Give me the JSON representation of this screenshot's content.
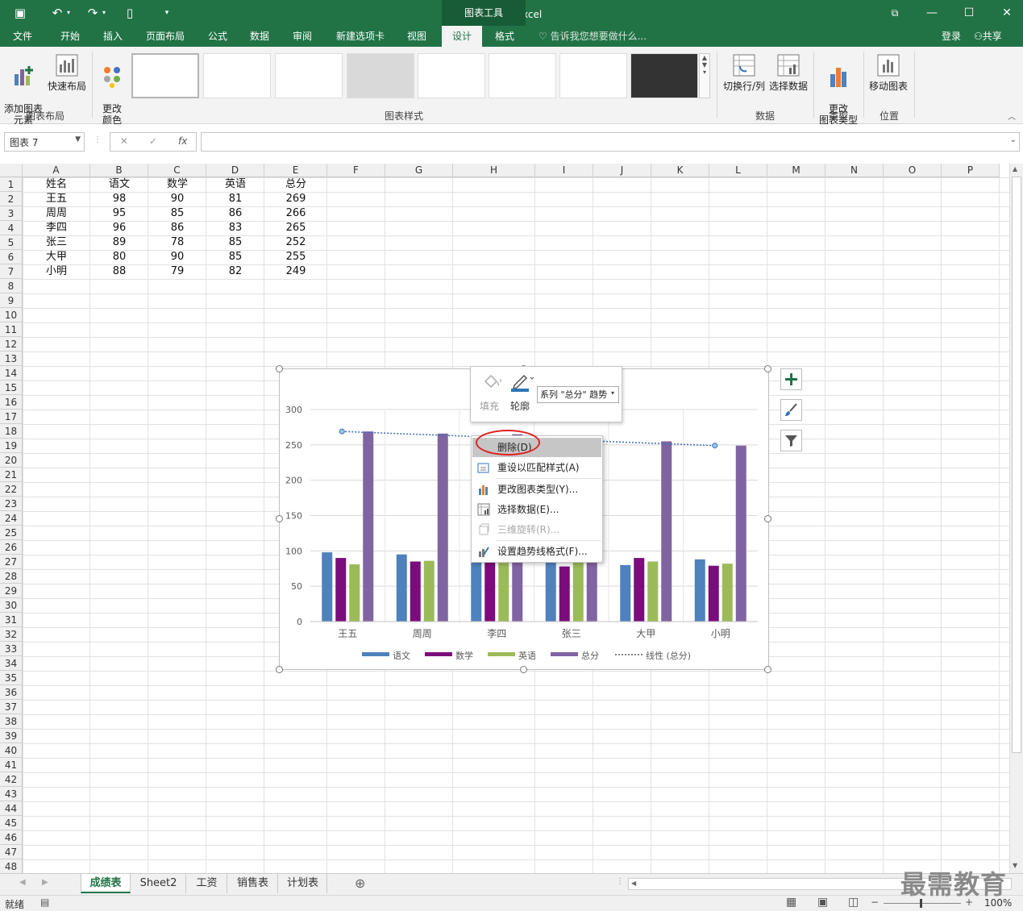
{
  "titlebar": {
    "title": "表格1 - Excel",
    "chart_tools": "图表工具"
  },
  "tabs": [
    "文件",
    "开始",
    "插入",
    "页面布局",
    "公式",
    "数据",
    "审阅",
    "新建选项卡",
    "视图",
    "设计",
    "格式"
  ],
  "active_tab": "设计",
  "tell_me": "告诉我您想要做什么...",
  "account": {
    "login": "登录",
    "share": "共享"
  },
  "ribbon": {
    "add_element": "添加图表\n元素",
    "quick_layout": "快速布局",
    "change_color": "更改\n颜色",
    "switch_row_col": "切换行/列",
    "select_data": "选择数据",
    "change_type": "更改\n图表类型",
    "move_chart": "移动图表",
    "groups": {
      "layout": "图表布局",
      "styles": "图表样式",
      "data": "数据",
      "type": "类型",
      "location": "位置"
    }
  },
  "name_box": "图表 7",
  "fx_label": "fx",
  "columns": [
    "A",
    "B",
    "C",
    "D",
    "E",
    "F",
    "G",
    "H",
    "I",
    "J",
    "K",
    "L",
    "M",
    "N",
    "O",
    "P"
  ],
  "rows": [
    "1",
    "2",
    "3",
    "4",
    "5",
    "6",
    "7",
    "8",
    "9",
    "10",
    "11",
    "12",
    "13",
    "14",
    "15",
    "16",
    "17",
    "18",
    "19",
    "20",
    "21",
    "22",
    "23",
    "24",
    "25",
    "26",
    "27",
    "28",
    "29",
    "30",
    "31",
    "32",
    "33",
    "34",
    "35",
    "36",
    "37",
    "38",
    "39",
    "40",
    "41",
    "42",
    "43",
    "44",
    "45",
    "46",
    "47",
    "48"
  ],
  "table": {
    "headers": [
      "姓名",
      "语文",
      "数学",
      "英语",
      "总分"
    ],
    "rows": [
      [
        "王五",
        "98",
        "90",
        "81",
        "269"
      ],
      [
        "周周",
        "95",
        "85",
        "86",
        "266"
      ],
      [
        "李四",
        "96",
        "86",
        "83",
        "265"
      ],
      [
        "张三",
        "89",
        "78",
        "85",
        "252"
      ],
      [
        "大甲",
        "80",
        "90",
        "85",
        "255"
      ],
      [
        "小明",
        "88",
        "79",
        "82",
        "249"
      ]
    ]
  },
  "mini_toolbar": {
    "fill": "填充",
    "outline": "轮廓",
    "series_select": "系列 \"总分\" 趋势"
  },
  "context_menu": {
    "items": [
      "删除(D)",
      "重设以匹配样式(A)",
      "更改图表类型(Y)...",
      "选择数据(E)...",
      "三维旋转(R)...",
      "设置趋势线格式(F)..."
    ]
  },
  "sheets": [
    "成绩表",
    "Sheet2",
    "工资",
    "销售表",
    "计划表"
  ],
  "active_sheet": "成绩表",
  "status": {
    "ready": "就绪",
    "zoom": "100%"
  },
  "watermark": "最需教育",
  "chart_data": {
    "type": "bar",
    "categories": [
      "王五",
      "周周",
      "李四",
      "张三",
      "大甲",
      "小明"
    ],
    "series": [
      {
        "name": "语文",
        "values": [
          98,
          95,
          96,
          89,
          80,
          88
        ],
        "color": "#4f81bd"
      },
      {
        "name": "数学",
        "values": [
          90,
          85,
          86,
          78,
          90,
          79
        ],
        "color": "#7b0c7b"
      },
      {
        "name": "英语",
        "values": [
          81,
          86,
          83,
          85,
          85,
          82
        ],
        "color": "#9bbb59"
      },
      {
        "name": "总分",
        "values": [
          269,
          266,
          265,
          252,
          255,
          249
        ],
        "color": "#8064a2"
      }
    ],
    "trendline": {
      "name": "线性 (总分)",
      "start": 269,
      "end": 249,
      "color": "#3d6cb3"
    },
    "ylim": [
      0,
      300
    ],
    "yticks": [
      0,
      50,
      100,
      150,
      200,
      250,
      300
    ],
    "grid": true,
    "legend": "bottom"
  }
}
